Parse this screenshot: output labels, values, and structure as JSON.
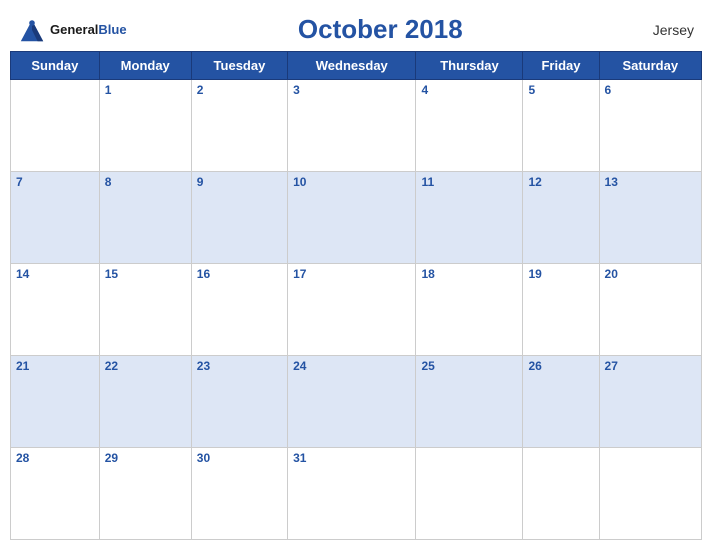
{
  "header": {
    "logo_general": "General",
    "logo_blue": "Blue",
    "title": "October 2018",
    "region": "Jersey"
  },
  "weekdays": [
    "Sunday",
    "Monday",
    "Tuesday",
    "Wednesday",
    "Thursday",
    "Friday",
    "Saturday"
  ],
  "weeks": [
    [
      null,
      1,
      2,
      3,
      4,
      5,
      6
    ],
    [
      7,
      8,
      9,
      10,
      11,
      12,
      13
    ],
    [
      14,
      15,
      16,
      17,
      18,
      19,
      20
    ],
    [
      21,
      22,
      23,
      24,
      25,
      26,
      27
    ],
    [
      28,
      29,
      30,
      31,
      null,
      null,
      null
    ]
  ]
}
